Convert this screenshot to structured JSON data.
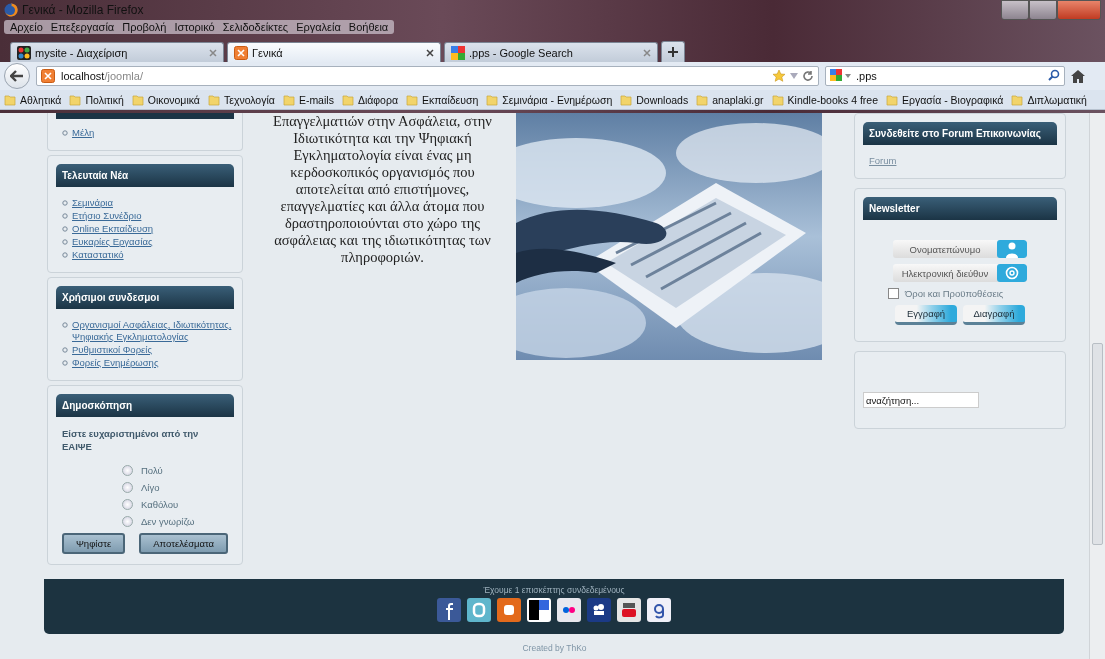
{
  "window": {
    "title": "Γενικά - Mozilla Firefox"
  },
  "menu": [
    "Αρχείο",
    "Επεξεργασία",
    "Προβολή",
    "Ιστορικό",
    "Σελιδοδείκτες",
    "Εργαλεία",
    "Βοήθεια"
  ],
  "tabs": [
    {
      "label": "mysite - Διαχείριση",
      "selected": false
    },
    {
      "label": "Γενικά",
      "selected": true
    },
    {
      "label": ".pps - Google Search",
      "selected": false
    }
  ],
  "address_bar": {
    "host": "localhost",
    "path": "/joomla/"
  },
  "search_bar": {
    "value": ".pps"
  },
  "bookmarks": [
    "Αθλητικά",
    "Πολιτική",
    "Οικονομικά",
    "Τεχνολογία",
    "E-mails",
    "Διάφορα",
    "Εκπαίδευση",
    "Σεμινάρια - Ενημέρωση",
    "Downloads",
    "anaplaki.gr",
    "Kindle-books 4 free",
    "Εργασία - Βιογραφικά",
    "Διπλωματική"
  ],
  "left_modules": [
    {
      "kind": "links",
      "items": [
        "Μέλη"
      ]
    },
    {
      "kind": "links",
      "title": "Τελευταία Νέα",
      "items": [
        "Σεμινάρια",
        "Ετήσιο Συνέδριο",
        "Online Εκπαίδευση",
        "Ευκαρίες Εργασίας",
        "Καταστατικό"
      ]
    },
    {
      "kind": "links",
      "title": "Χρήσιμοι συνδεσμοι",
      "items": [
        "Οργανισμοί Ασφάλειας, Ιδιωτικότητας, Ψηφιακής Εγκληματολογίας",
        "Ρυθμιστικοί Φορείς",
        "Φορείς Ενημέρωσης"
      ]
    },
    {
      "kind": "poll",
      "title": "Δημοσκόπηση",
      "question": "Είστε ευχαριστημένοι από την ΕΑΙΨΕ",
      "options": [
        {
          "label": "Πολύ",
          "selected": false
        },
        {
          "label": "Λίγο",
          "selected": false
        },
        {
          "label": "Καθόλου",
          "selected": false
        },
        {
          "label": "Δεν γνωρίζω",
          "selected": false
        }
      ],
      "buttons": [
        "Ψηφίστε",
        "Αποτελέσματα"
      ]
    }
  ],
  "intro_text": "Επαγγελματιών στην Ασφάλεια, στην Ιδιωτικότητα και την Ψηφιακή Εγκληματολογία είναι ένας μη κερδοσκοπικός οργανισμός που αποτελείται από επιστήμονες, επαγγελματίες και άλλα άτομα που δραστηροποιούνται στο χώρο της ασφάλειας και της ιδιωτικότητας των πληροφοριών.",
  "right_modules": [
    {
      "kind": "links",
      "title": "Συνδεθείτε στο Forum Επικοινωνίας",
      "items": [
        "Forum"
      ]
    },
    {
      "kind": "newsletter",
      "title": "Newsletter",
      "fields": [
        {
          "kind": "name",
          "placeholder": "Ονοματεπώνυμο"
        },
        {
          "kind": "email",
          "placeholder": "Ηλεκτρονική διεύθυν"
        }
      ],
      "terms": {
        "label": "Όροι και Προϋποθέσεις",
        "checked": false
      },
      "buttons": [
        "Εγγραφή",
        "Διαγραφή"
      ]
    },
    {
      "kind": "search",
      "placeholder": "αναζήτηση..."
    }
  ],
  "footer": {
    "online": "Έχουμε 1 επισκέπτης συνδεδεμένους"
  },
  "credit": "Created by ThKo"
}
